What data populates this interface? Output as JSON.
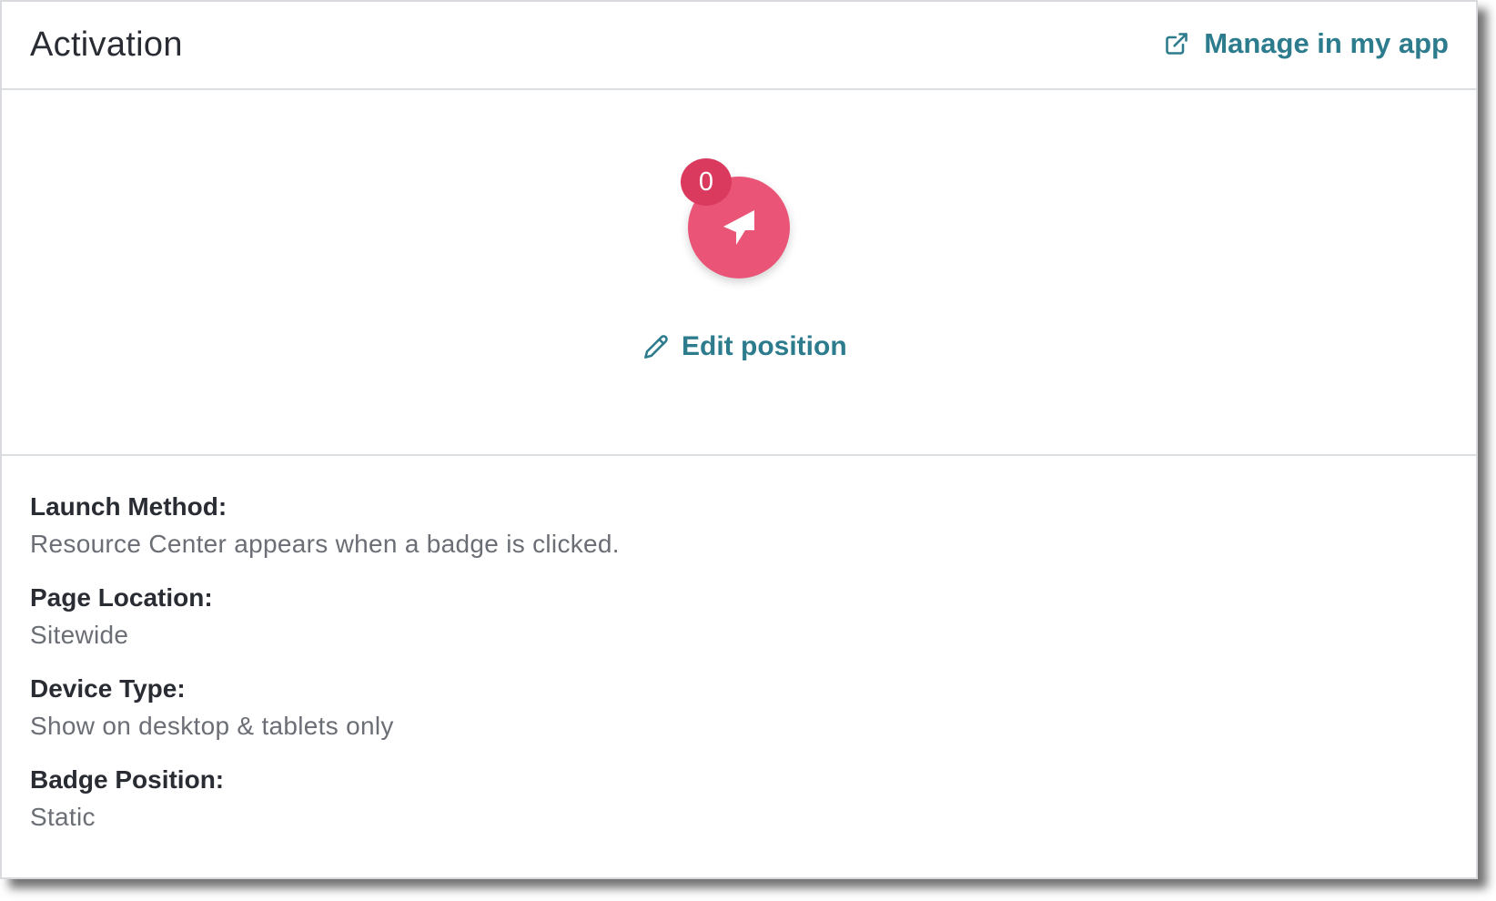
{
  "header": {
    "title": "Activation",
    "manage_link_label": "Manage in my app",
    "manage_icon": "external-link-icon"
  },
  "preview": {
    "badge_count": "0",
    "badge_icon": "resource-center-arrow-icon",
    "edit_label": "Edit position",
    "edit_icon": "pencil-icon"
  },
  "details": {
    "launch_method": {
      "label": "Launch Method:",
      "value": "Resource Center appears when a badge is clicked."
    },
    "page_location": {
      "label": "Page Location:",
      "value": "Sitewide"
    },
    "device_type": {
      "label": "Device Type:",
      "value": "Show on desktop & tablets only"
    },
    "badge_position": {
      "label": "Badge Position:",
      "value": "Static"
    }
  },
  "colors": {
    "accent": "#2d7c8e",
    "badge": "#ea5577",
    "badge_count_bg": "#d93a5e",
    "text_primary": "#2a2c33",
    "text_secondary": "#6b6e75",
    "divider": "#dcdfe2"
  }
}
